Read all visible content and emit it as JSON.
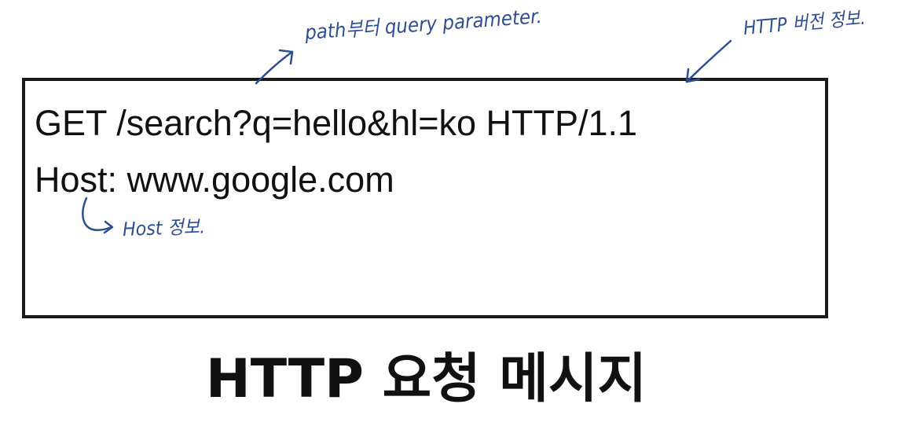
{
  "message": {
    "request_line": "GET /search?q=hello&hl=ko HTTP/1.1",
    "host_line": "Host: www.google.com"
  },
  "annotations": {
    "path_note": "path부터 query parameter.",
    "version_note": "HTTP 버전 정보.",
    "host_note": "Host 정보."
  },
  "caption": "HTTP 요청 메시지",
  "colors": {
    "annotation_ink": "#2c4e93",
    "box_border": "#1a1a1a",
    "text": "#111111"
  }
}
